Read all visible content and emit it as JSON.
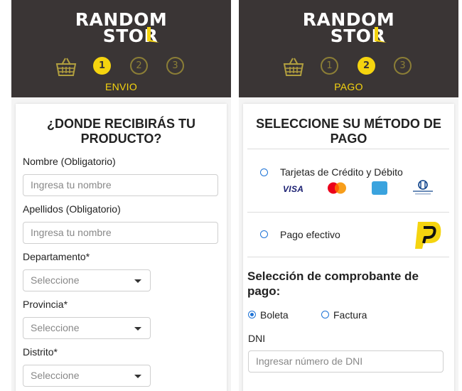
{
  "brand": {
    "line1": "RANDOM",
    "line2": "STOR",
    "accent": "#f5d40f",
    "header_bg": "#3a3535"
  },
  "left": {
    "steps": [
      "1",
      "2",
      "3"
    ],
    "active_step": 1,
    "step_label": "ENVIO",
    "title": "¿DONDE RECIBIRÁS TU PRODUCTO?",
    "fields": {
      "nombre": {
        "label": "Nombre (Obligatorio)",
        "placeholder": "Ingresa tu nombre"
      },
      "apellidos": {
        "label": "Apellidos (Obligatorio)",
        "placeholder": "Ingresa tu nombre"
      },
      "departamento": {
        "label": "Departamento*",
        "value": "Seleccione"
      },
      "provincia": {
        "label": "Provincia*",
        "value": "Seleccione"
      },
      "distrito": {
        "label": "Distrito*",
        "value": "Seleccione"
      }
    }
  },
  "right": {
    "steps": [
      "1",
      "2",
      "3"
    ],
    "active_step": 2,
    "step_label": "PAGO",
    "title": "SELECCIONE SU MÉTODO DE PAGO",
    "methods": {
      "cards": {
        "label": "Tarjetas de Crédito y Débito",
        "logos": [
          "VISA",
          "MasterCard",
          "American Express",
          "Diners Club"
        ]
      },
      "cash": {
        "label": "Pago efectivo"
      }
    },
    "receipt": {
      "title": "Selección de comprobante de pago:",
      "options": {
        "boleta": "Boleta",
        "factura": "Factura"
      },
      "selected": "Boleta"
    },
    "dni": {
      "label": "DNI",
      "placeholder": "Ingresar número de DNI"
    }
  },
  "icons": [
    "basket-icon",
    "caret-down-icon",
    "visa-logo",
    "mastercard-logo",
    "amex-logo",
    "diners-logo",
    "pagoefectivo-logo"
  ]
}
